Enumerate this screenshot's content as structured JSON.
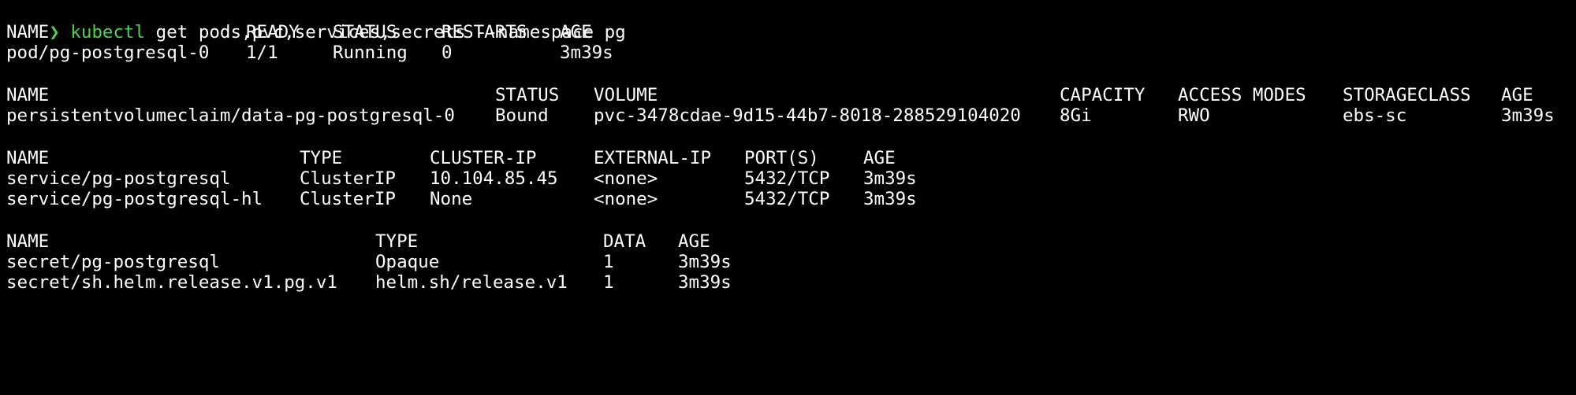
{
  "prompt": {
    "symbol": "❯",
    "command": "kubectl",
    "args": " get pods,pvc,services,secrets --namespace pg"
  },
  "colors": {
    "background": "#000000",
    "text": "#ffffff",
    "prompt_green": "#4fd24f"
  },
  "pods": {
    "headers": [
      "NAME",
      "READY",
      "STATUS",
      "RESTARTS",
      "AGE"
    ],
    "rows": [
      [
        "pod/pg-postgresql-0",
        "1/1",
        "Running",
        "0",
        "3m39s"
      ]
    ]
  },
  "pvc": {
    "headers": [
      "NAME",
      "STATUS",
      "VOLUME",
      "CAPACITY",
      "ACCESS MODES",
      "STORAGECLASS",
      "AGE"
    ],
    "rows": [
      [
        "persistentvolumeclaim/data-pg-postgresql-0",
        "Bound",
        "pvc-3478cdae-9d15-44b7-8018-288529104020",
        "8Gi",
        "RWO",
        "ebs-sc",
        "3m39s"
      ]
    ]
  },
  "services": {
    "headers": [
      "NAME",
      "TYPE",
      "CLUSTER-IP",
      "EXTERNAL-IP",
      "PORT(S)",
      "AGE"
    ],
    "rows": [
      [
        "service/pg-postgresql",
        "ClusterIP",
        "10.104.85.45",
        "<none>",
        "5432/TCP",
        "3m39s"
      ],
      [
        "service/pg-postgresql-hl",
        "ClusterIP",
        "None",
        "<none>",
        "5432/TCP",
        "3m39s"
      ]
    ]
  },
  "secrets": {
    "headers": [
      "NAME",
      "TYPE",
      "DATA",
      "AGE"
    ],
    "rows": [
      [
        "secret/pg-postgresql",
        "Opaque",
        "1",
        "3m39s"
      ],
      [
        "secret/sh.helm.release.v1.pg.v1",
        "helm.sh/release.v1",
        "1",
        "3m39s"
      ]
    ]
  }
}
